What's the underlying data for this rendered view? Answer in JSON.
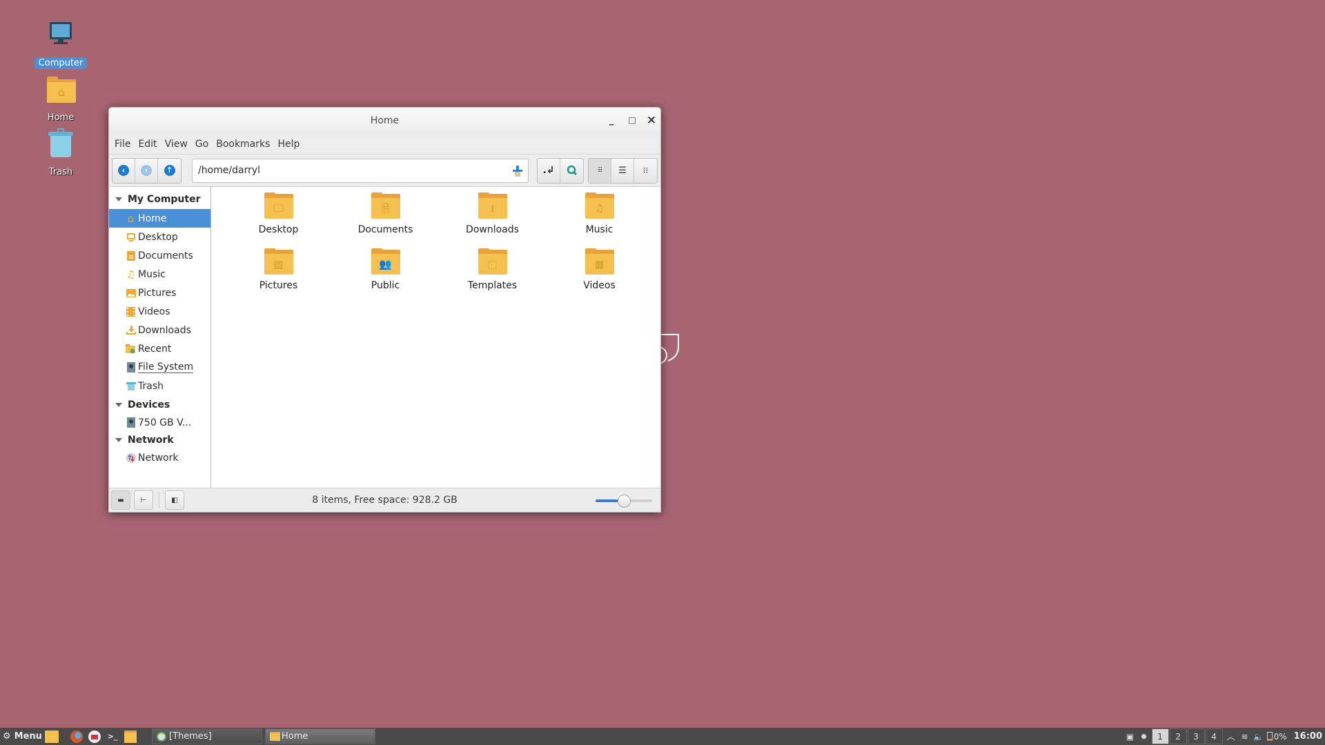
{
  "desktop": {
    "icons": [
      {
        "label": "Computer",
        "icon": "computer-icon",
        "selected": true
      },
      {
        "label": "Home",
        "icon": "home-folder-icon",
        "selected": false
      },
      {
        "label": "Trash",
        "icon": "trash-icon",
        "selected": false
      }
    ]
  },
  "window": {
    "title": "Home",
    "controls": {
      "minimize": "_",
      "maximize": "□",
      "close": "×"
    },
    "menu": [
      "File",
      "Edit",
      "View",
      "Go",
      "Bookmarks",
      "Help"
    ],
    "toolbar": {
      "back_icon": "arrow-left-icon",
      "forward_icon": "arrow-right-icon",
      "up_icon": "arrow-up-icon",
      "location": "/home/darryl",
      "location_icon": "pin-icon",
      "toggle_location_icon": "text-entry-icon",
      "search_icon": "search-icon",
      "views": [
        {
          "name": "icon-view",
          "active": true
        },
        {
          "name": "list-view",
          "active": false
        },
        {
          "name": "compact-view",
          "active": false
        }
      ]
    },
    "sidebar": {
      "sections": [
        {
          "title": "My Computer",
          "items": [
            {
              "label": "Home",
              "icon": "home-icon",
              "selected": true
            },
            {
              "label": "Desktop",
              "icon": "desktop-icon"
            },
            {
              "label": "Documents",
              "icon": "document-icon"
            },
            {
              "label": "Music",
              "icon": "music-icon"
            },
            {
              "label": "Pictures",
              "icon": "picture-icon"
            },
            {
              "label": "Videos",
              "icon": "video-icon"
            },
            {
              "label": "Downloads",
              "icon": "download-icon"
            },
            {
              "label": "Recent",
              "icon": "recent-icon"
            },
            {
              "label": "File System",
              "icon": "drive-icon"
            },
            {
              "label": "Trash",
              "icon": "trash-icon"
            }
          ]
        },
        {
          "title": "Devices",
          "items": [
            {
              "label": "750 GB V...",
              "icon": "drive-icon"
            }
          ]
        },
        {
          "title": "Network",
          "items": [
            {
              "label": "Network",
              "icon": "network-icon"
            }
          ]
        }
      ]
    },
    "files": [
      {
        "name": "Desktop",
        "glyph": "🖵"
      },
      {
        "name": "Documents",
        "glyph": "🗎"
      },
      {
        "name": "Downloads",
        "glyph": "⭳"
      },
      {
        "name": "Music",
        "glyph": "♫"
      },
      {
        "name": "Pictures",
        "glyph": "▨"
      },
      {
        "name": "Public",
        "glyph": "👥"
      },
      {
        "name": "Templates",
        "glyph": "⬚"
      },
      {
        "name": "Videos",
        "glyph": "▦"
      }
    ],
    "status": {
      "text": "8 items, Free space: 928.2 GB",
      "zoom_level": 0.5
    }
  },
  "taskbar": {
    "menu_label": "Menu",
    "launchers": [
      "show-desktop-icon",
      "firefox-icon",
      "mail-icon",
      "terminal-icon",
      "files-icon"
    ],
    "tasks": [
      {
        "label": "[Themes]",
        "icon": "themes-icon"
      },
      {
        "label": "Home",
        "icon": "folder-icon"
      }
    ],
    "workspaces": [
      "1",
      "2",
      "3",
      "4"
    ],
    "active_workspace": 0,
    "battery": "0%",
    "clock": "16:00"
  }
}
